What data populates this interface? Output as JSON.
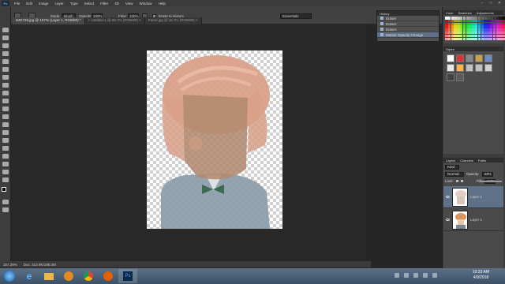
{
  "app": {
    "logo": "Ps"
  },
  "menu": [
    "File",
    "Edit",
    "Image",
    "Layer",
    "Type",
    "Select",
    "Filter",
    "3D",
    "View",
    "Window",
    "Help"
  ],
  "window_controls": [
    "–",
    "□",
    "✕"
  ],
  "options_bar": {
    "mode_label": "Mode:",
    "mode_value": "Brush",
    "opacity_label": "Opacity:",
    "opacity_value": "100%",
    "flow_label": "Flow:",
    "flow_value": "100%",
    "erase_to_history": "Erase to History",
    "workspace": "Essentials"
  },
  "doc_tabs": [
    {
      "label": "IMG729.jpg @ 157% (Layer 1, RGB/8#) *",
      "active": true
    },
    {
      "label": "× Untitled-1 @ 66.7% (RGB/8#) ×",
      "active": false
    },
    {
      "label": "Farrel.jpg @ 16.7% (RGB/8#) ×",
      "active": false
    }
  ],
  "history": {
    "title": "History",
    "rows": [
      {
        "label": "Eraser",
        "selected": false
      },
      {
        "label": "Eraser",
        "selected": false
      },
      {
        "label": "Eraser",
        "selected": false
      },
      {
        "label": "Master Opacity Change",
        "selected": true
      }
    ]
  },
  "swatches": {
    "tabs": [
      "Color",
      "Swatches",
      "Adjustments"
    ]
  },
  "styles": {
    "title": "Styles"
  },
  "layers": {
    "tabs": [
      "Layers",
      "Channels",
      "Paths"
    ],
    "kind_label": "Kind",
    "blend_mode": "Normal",
    "opacity_label": "Opacity:",
    "opacity_value": "33%",
    "lock_label": "Lock:",
    "fill_label": "Fill:",
    "fill_value": "100%",
    "items": [
      {
        "name": "Layer 1",
        "selected": true
      },
      {
        "name": "Layer 1",
        "selected": false
      }
    ]
  },
  "status": {
    "zoom": "157.29%",
    "doc": "Doc: 413.9K/195.0M"
  },
  "taskbar": {
    "time": "10:33 AM",
    "date": "4/9/2018"
  },
  "colors": {
    "hair": "#d9a08a",
    "skin": "#b28a70",
    "shirt": "#8a9aa8",
    "bowtie": "#3d6a52",
    "panel_select": "#5f7089"
  }
}
